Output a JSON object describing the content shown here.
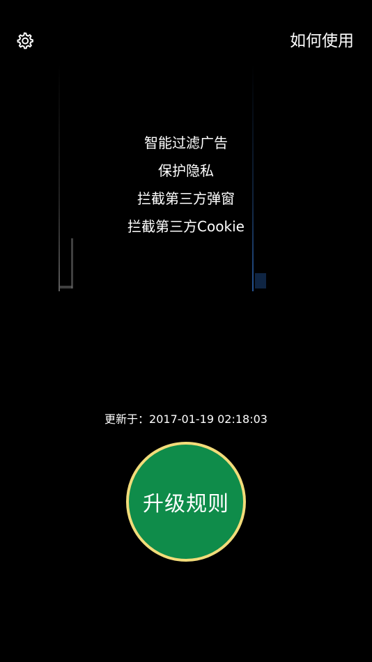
{
  "header": {
    "settings_icon": "gear-icon",
    "help_label": "如何使用"
  },
  "features": [
    "智能过滤广告",
    "保护隐私",
    "拦截第三方弹窗",
    "拦截第三方Cookie"
  ],
  "update": {
    "label": "更新于：2017-01-19 02:18:03"
  },
  "upgrade_button": {
    "label": "升级规则"
  },
  "colors": {
    "background": "#000000",
    "button_fill": "#0f8c4a",
    "button_ring": "#f2dc7a",
    "text": "#ffffff"
  }
}
